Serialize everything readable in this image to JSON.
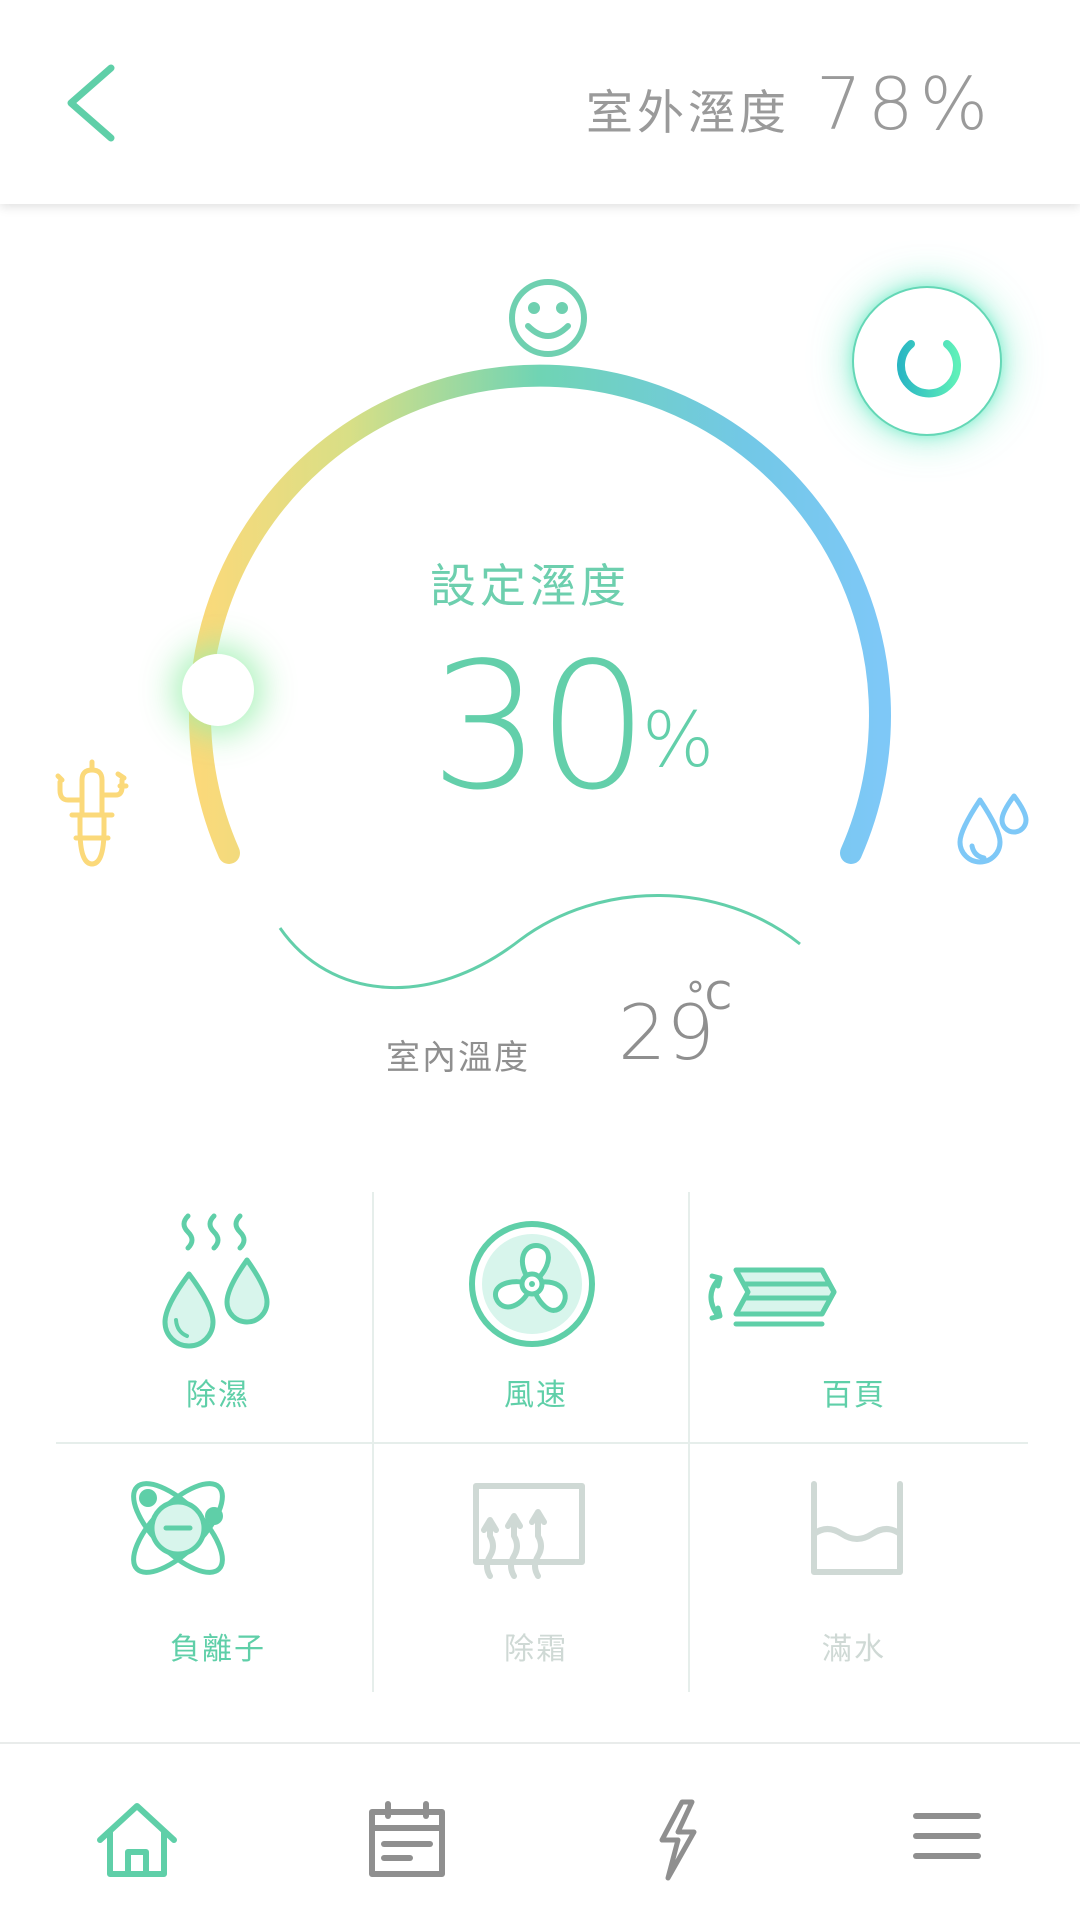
{
  "header": {
    "outdoor_label": "室外溼度",
    "outdoor_value": "78%"
  },
  "dial": {
    "set_label": "設定溼度",
    "set_value": "30",
    "set_unit": "%",
    "range_start_icon": "cactus-icon",
    "range_end_icon": "water-drops-icon",
    "status_icon": "smile-icon",
    "power_icon": "power-icon"
  },
  "indoor": {
    "label": "室內溫度",
    "value": "29",
    "unit": "°C"
  },
  "functions": [
    {
      "label": "除濕",
      "icon": "dehumidify-icon",
      "enabled": true
    },
    {
      "label": "風速",
      "icon": "fan-icon",
      "enabled": true
    },
    {
      "label": "百頁",
      "icon": "louver-icon",
      "enabled": true
    },
    {
      "label": "負離子",
      "icon": "ion-icon",
      "enabled": true
    },
    {
      "label": "除霜",
      "icon": "defrost-icon",
      "enabled": false
    },
    {
      "label": "滿水",
      "icon": "water-tank-icon",
      "enabled": false
    }
  ],
  "nav": [
    {
      "icon": "home-icon",
      "active": true
    },
    {
      "icon": "calendar-icon",
      "active": false
    },
    {
      "icon": "lightning-icon",
      "active": false
    },
    {
      "icon": "menu-icon",
      "active": false
    }
  ],
  "colors": {
    "accent": "#5fcfa8",
    "arc_start": "#fbd97a",
    "arc_mid": "#6fd4b4",
    "arc_end": "#7ec8f7",
    "disabled": "#cfd9d5",
    "text_gray": "#9a9a9a"
  }
}
